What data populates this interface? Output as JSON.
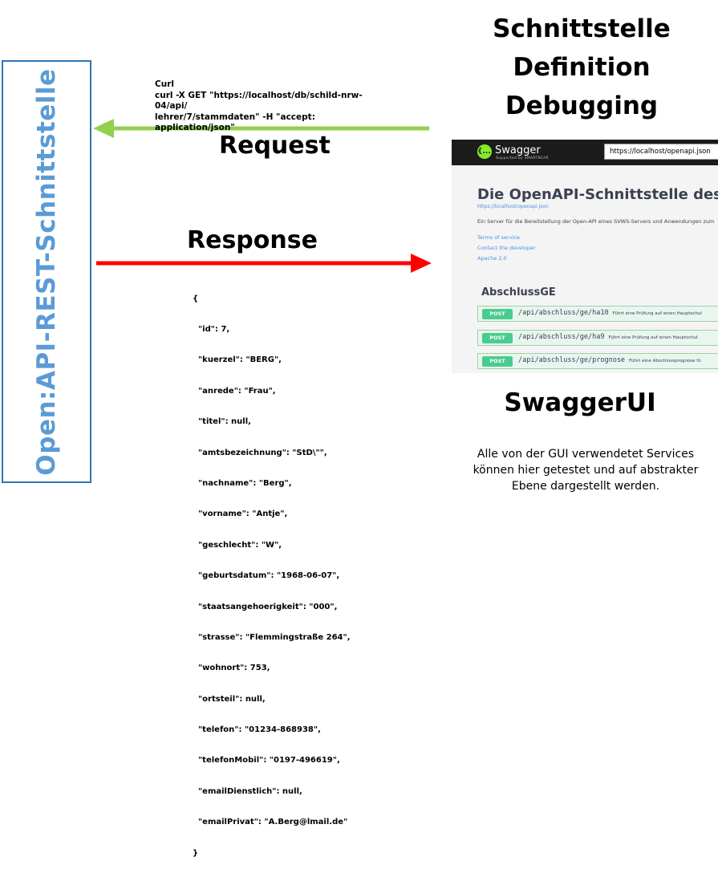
{
  "left_box": {
    "label": "Open:API-REST-Schnittstelle",
    "color": "#5b9bd5"
  },
  "curl": {
    "lines": [
      "Curl",
      "curl -X GET \"https://localhost/db/schild-nrw-04/api/",
      "lehrer/7/stammdaten\" -H  \"accept: application/json\""
    ]
  },
  "request": {
    "label": "Request",
    "arrow_color": "#92d050"
  },
  "response": {
    "label": "Response",
    "arrow_color": "#ff0000"
  },
  "json_response": [
    "{",
    "  \"id\": 7,",
    "  \"kuerzel\": \"BERG\",",
    "  \"anrede\": \"Frau\",",
    "  \"titel\": null,",
    "  \"amtsbezeichnung\": \"StD\\\"\",",
    "  \"nachname\": \"Berg\",",
    "  \"vorname\": \"Antje\",",
    "  \"geschlecht\": \"W\",",
    "  \"geburtsdatum\": \"1968-06-07\",",
    "  \"staatsangehoerigkeit\": \"000\",",
    "  \"strasse\": \"Flemmingstraße 264\",",
    "  \"wohnort\": 753,",
    "  \"ortsteil\": null,",
    "  \"telefon\": \"01234-868938\",",
    "  \"telefonMobil\": \"0197-496619\",",
    "  \"emailDienstlich\": null,",
    "  \"emailPrivat\": \"A.Berg@lmail.de\"",
    "}"
  ],
  "heading": {
    "line1": "Schnittstelle",
    "line2": "Definition",
    "line3": "Debugging"
  },
  "swagger": {
    "brand": "Swagger",
    "brand_sub": "Supported by SMARTBEAR",
    "logo_glyph": "{...}",
    "url": "https://localhost/openapi.json",
    "title": "Die OpenAPI-Schnittstelle des SV",
    "link": "https://localhost/openapi.json",
    "description": "Ein Server für die Bereitstellung der Open-API eines SVWS-Servers und Anwendungen zum",
    "terms": "Terms of service",
    "contact": "Contact the developer",
    "license": "Apache 2.0",
    "group": "AbschlussGE",
    "method_label": "POST",
    "operations": [
      {
        "path": "/api/abschluss/ge/ha10",
        "summary": "Führt eine Prüfung auf einen Hauptschul"
      },
      {
        "path": "/api/abschluss/ge/ha9",
        "summary": "Führt eine Prüfung auf einen Hauptschul"
      },
      {
        "path": "/api/abschluss/ge/prognose",
        "summary": "Führt eine Abschlussprognose fü"
      }
    ]
  },
  "swaggerui_label": "SwaggerUI",
  "caption": {
    "line1": "Alle von der GUI verwendetet Services",
    "line2": "können hier getestet und auf abstrakter",
    "line3": "Ebene dargestellt werden."
  }
}
